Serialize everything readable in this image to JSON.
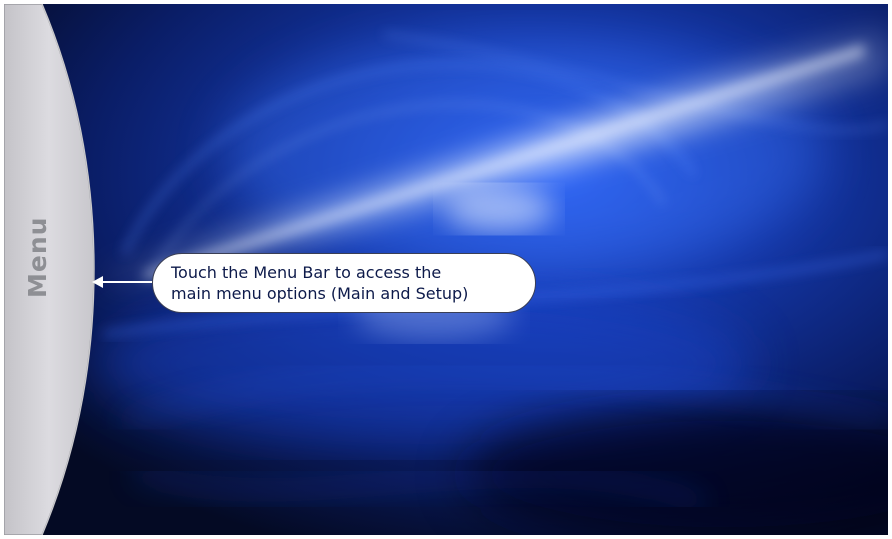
{
  "menu_bar": {
    "label": "Menu"
  },
  "callout": {
    "line1": "Touch the Menu Bar to access the",
    "line2": "main menu options (Main and Setup)"
  },
  "colors": {
    "background_deep": "#07102e",
    "background_blue": "#1d4fd8",
    "menu_bar_fill": "#d3d2d6",
    "menu_label": "#8e8f94",
    "callout_text": "#0d1a4a"
  },
  "icons": {
    "pointer": "arrow-left-icon"
  }
}
